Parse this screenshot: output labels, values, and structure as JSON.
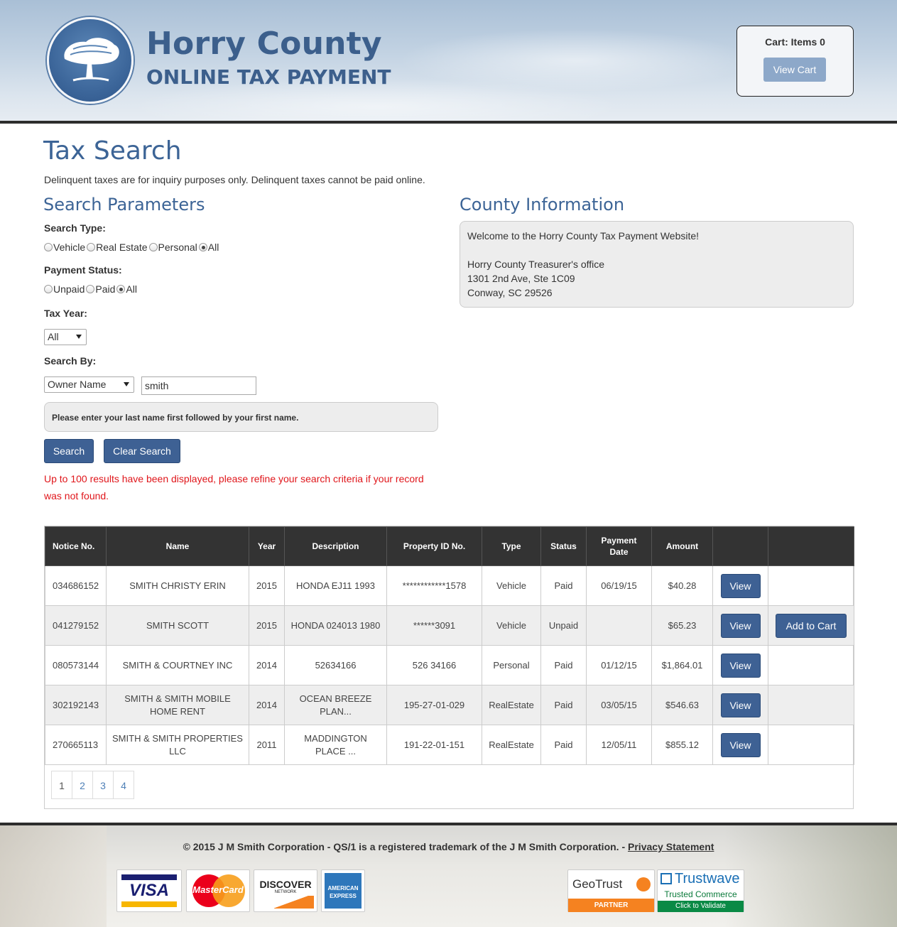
{
  "header": {
    "title": "Horry County",
    "subtitle": "ONLINE TAX PAYMENT",
    "cart_label": "Cart: Items 0",
    "view_cart": "View Cart"
  },
  "main": {
    "title": "Tax Search",
    "notice": "Delinquent taxes are for inquiry purposes only. Delinquent taxes cannot be paid online.",
    "search_section_title": "Search Parameters",
    "search_type_label": "Search Type:",
    "search_type_options": [
      "Vehicle",
      "Real Estate",
      "Personal",
      "All"
    ],
    "search_type_selected": "All",
    "payment_status_label": "Payment Status:",
    "payment_status_options": [
      "Unpaid",
      "Paid",
      "All"
    ],
    "payment_status_selected": "All",
    "tax_year_label": "Tax Year:",
    "tax_year_value": "All",
    "search_by_label": "Search By:",
    "search_by_value": "Owner Name",
    "search_text": "smith",
    "hint": "Please enter your last name first followed by your first name.",
    "search_button": "Search",
    "clear_button": "Clear Search",
    "warning": "Up to 100 results have been displayed, please refine your search criteria if your record was not found."
  },
  "county": {
    "title": "County Information",
    "welcome": "Welcome to the Horry County Tax Payment Website!",
    "office": "Horry County Treasurer's office",
    "address1": "1301 2nd Ave, Ste 1C09",
    "address2": "Conway, SC 29526"
  },
  "table": {
    "headers": [
      "Notice No.",
      "Name",
      "Year",
      "Description",
      "Property ID No.",
      "Type",
      "Status",
      "Payment Date",
      "Amount"
    ],
    "view_label": "View",
    "add_label": "Add to Cart",
    "rows": [
      {
        "notice": "034686152",
        "name": "SMITH CHRISTY ERIN",
        "year": "2015",
        "description": "HONDA EJ11 1993",
        "property_id": "************1578",
        "type": "Vehicle",
        "status": "Paid",
        "payment_date": "06/19/15",
        "amount": "$40.28",
        "add": false
      },
      {
        "notice": "041279152",
        "name": "SMITH SCOTT",
        "year": "2015",
        "description": "HONDA 024013 1980",
        "property_id": "******3091",
        "type": "Vehicle",
        "status": "Unpaid",
        "payment_date": "",
        "amount": "$65.23",
        "add": true
      },
      {
        "notice": "080573144",
        "name": "SMITH & COURTNEY INC",
        "year": "2014",
        "description": "52634166",
        "property_id": "526 34166",
        "type": "Personal",
        "status": "Paid",
        "payment_date": "01/12/15",
        "amount": "$1,864.01",
        "add": false
      },
      {
        "notice": "302192143",
        "name": "SMITH & SMITH MOBILE HOME RENT",
        "year": "2014",
        "description": "OCEAN BREEZE PLAN...",
        "property_id": "195-27-01-029",
        "type": "RealEstate",
        "status": "Paid",
        "payment_date": "03/05/15",
        "amount": "$546.63",
        "add": false
      },
      {
        "notice": "270665113",
        "name": "SMITH & SMITH PROPERTIES LLC",
        "year": "2011",
        "description": "MADDINGTON PLACE ...",
        "property_id": "191-22-01-151",
        "type": "RealEstate",
        "status": "Paid",
        "payment_date": "12/05/11",
        "amount": "$855.12",
        "add": false
      }
    ],
    "pages": [
      "1",
      "2",
      "3",
      "4"
    ],
    "current_page": "1"
  },
  "footer": {
    "copyright": "© 2015 J M Smith Corporation - QS/1 is a registered trademark of the J M Smith Corporation. - ",
    "privacy": "Privacy Statement",
    "cards": {
      "visa": "VISA",
      "mastercard": "MasterCard",
      "discover": "DISCOVER",
      "discover_sub": "NETWORK",
      "amex1": "AMERICAN",
      "amex2": "EXPRESS"
    },
    "geotrust": "GeoTrust",
    "geotrust_sub": "PARTNER",
    "trustwave": "Trustwave",
    "trustwave_sub": "Trusted Commerce",
    "trustwave_validate": "Click to Validate"
  }
}
